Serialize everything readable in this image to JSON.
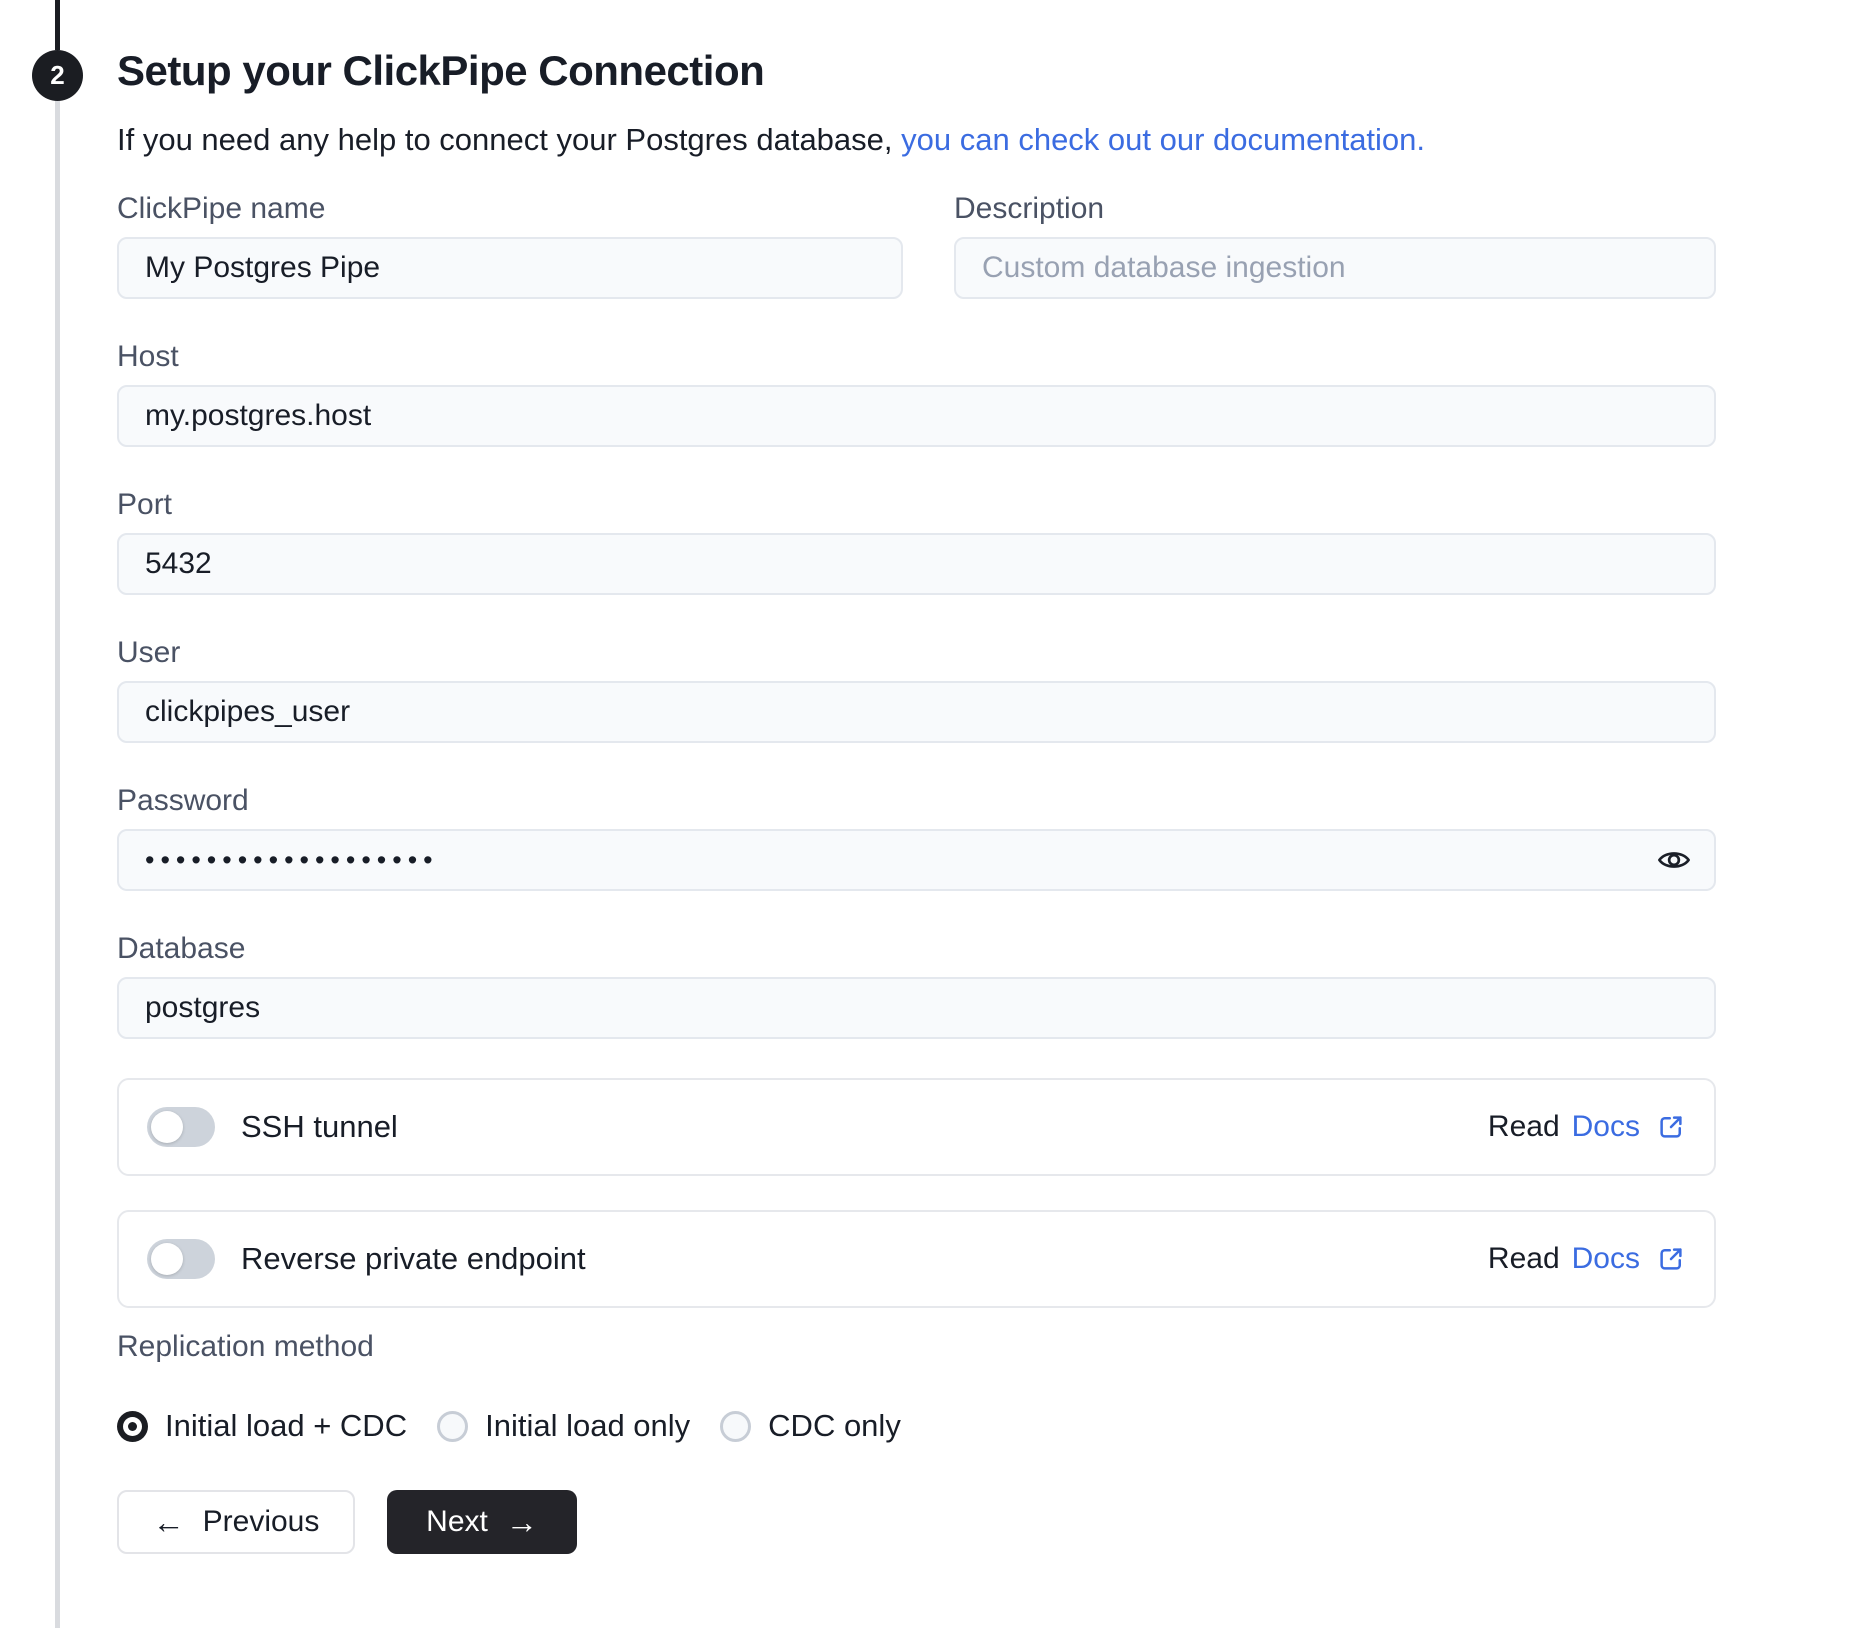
{
  "step": {
    "number": "2",
    "title": "Setup your ClickPipe Connection"
  },
  "intro": {
    "text_plain": "If you need any help to connect your Postgres database, ",
    "link_text": "you can check out our documentation."
  },
  "fields": {
    "clickpipe_name": {
      "label": "ClickPipe name",
      "value": "My Postgres Pipe"
    },
    "description": {
      "label": "Description",
      "placeholder": "Custom database ingestion"
    },
    "host": {
      "label": "Host",
      "value": "my.postgres.host"
    },
    "port": {
      "label": "Port",
      "value": "5432"
    },
    "user": {
      "label": "User",
      "value": "clickpipes_user"
    },
    "password": {
      "label": "Password",
      "masked_value": "•••••••••••••••••••"
    },
    "database": {
      "label": "Database",
      "value": "postgres"
    }
  },
  "toggles": [
    {
      "label": "SSH tunnel",
      "state": "off",
      "docs_prefix": "Read",
      "docs_link": "Docs"
    },
    {
      "label": "Reverse private endpoint",
      "state": "off",
      "docs_prefix": "Read",
      "docs_link": "Docs"
    }
  ],
  "replication": {
    "label": "Replication method",
    "options": [
      {
        "label": "Initial load + CDC",
        "selected": true
      },
      {
        "label": "Initial load only",
        "selected": false
      },
      {
        "label": "CDC only",
        "selected": false
      }
    ]
  },
  "buttons": {
    "previous": "Previous",
    "next": "Next"
  },
  "icons": {
    "arrow_left": "←",
    "arrow_right": "→",
    "password_visibility": "eye-icon",
    "external_link": "external-link-icon"
  },
  "colors": {
    "accent_blue": "#3B6CE1",
    "dark": "#1B1D22",
    "next_button_bg": "#242429",
    "input_bg": "#F8FAFC",
    "input_border": "#E4E8EE",
    "card_border": "#E6E8EC",
    "label_gray": "#4A5264",
    "placeholder_gray": "#98A1B2",
    "toggle_off_gray": "#CDD3DB",
    "rail_gray": "#D9DBDF"
  }
}
